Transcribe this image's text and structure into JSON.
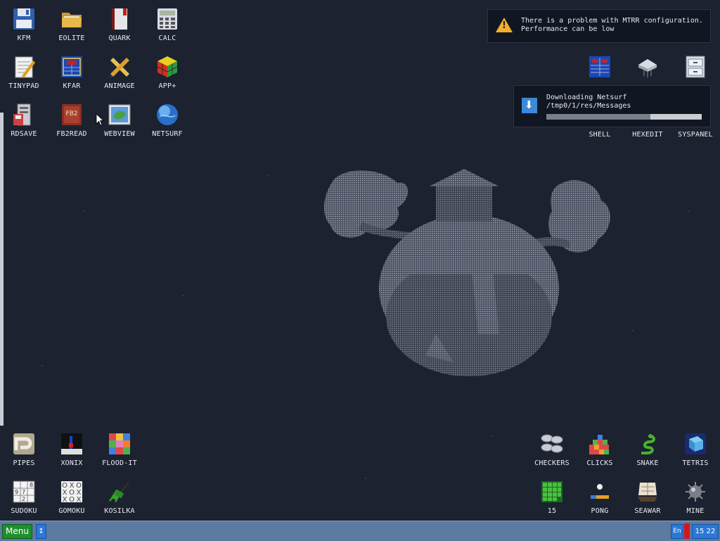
{
  "desktop_icons": {
    "kfm": "KFM",
    "eolite": "EOLITE",
    "quark": "QUARK",
    "calc": "CALC",
    "tinypad": "TINYPAD",
    "kfar": "KFAR",
    "animage": "ANIMAGE",
    "app_plus": "APP+",
    "rdsave": "RDSAVE",
    "fb2read": "FB2READ",
    "webview": "WEBVIEW",
    "netsurf": "NETSURF",
    "shell": "SHELL",
    "hexedit": "HEXEDIT",
    "syspanel": "SYSPANEL",
    "pipes": "PIPES",
    "xonix": "XONIX",
    "flood_it": "FLOOD-IT",
    "sudoku": "SUDOKU",
    "gomoku": "GOMOKU",
    "kosilka": "KOSILKA",
    "checkers": "CHECKERS",
    "clicks": "CLICKS",
    "snake": "SNAKE",
    "tetris": "TETRIS",
    "fifteen": "15",
    "pong": "PONG",
    "seawar": "SEAWAR",
    "mine": "MINE"
  },
  "notifications": {
    "warning": {
      "line1": "There is a problem with MTRR configuration.",
      "line2": "Performance can be low"
    },
    "download": {
      "line1": "Downloading Netsurf",
      "line2": "/tmp0/1/res/Messages",
      "progress": 0.67
    }
  },
  "taskbar": {
    "menu_label": "Menu",
    "arrows_label": "↕",
    "language": "En",
    "clock": "15 22"
  },
  "colors": {
    "desktop_bg": "#1c2230",
    "taskbar_bg": "#5d7aa0",
    "menu_green": "#1e8f2c",
    "accent_blue": "#2a78d8",
    "warning_yellow": "#f2b02c"
  }
}
